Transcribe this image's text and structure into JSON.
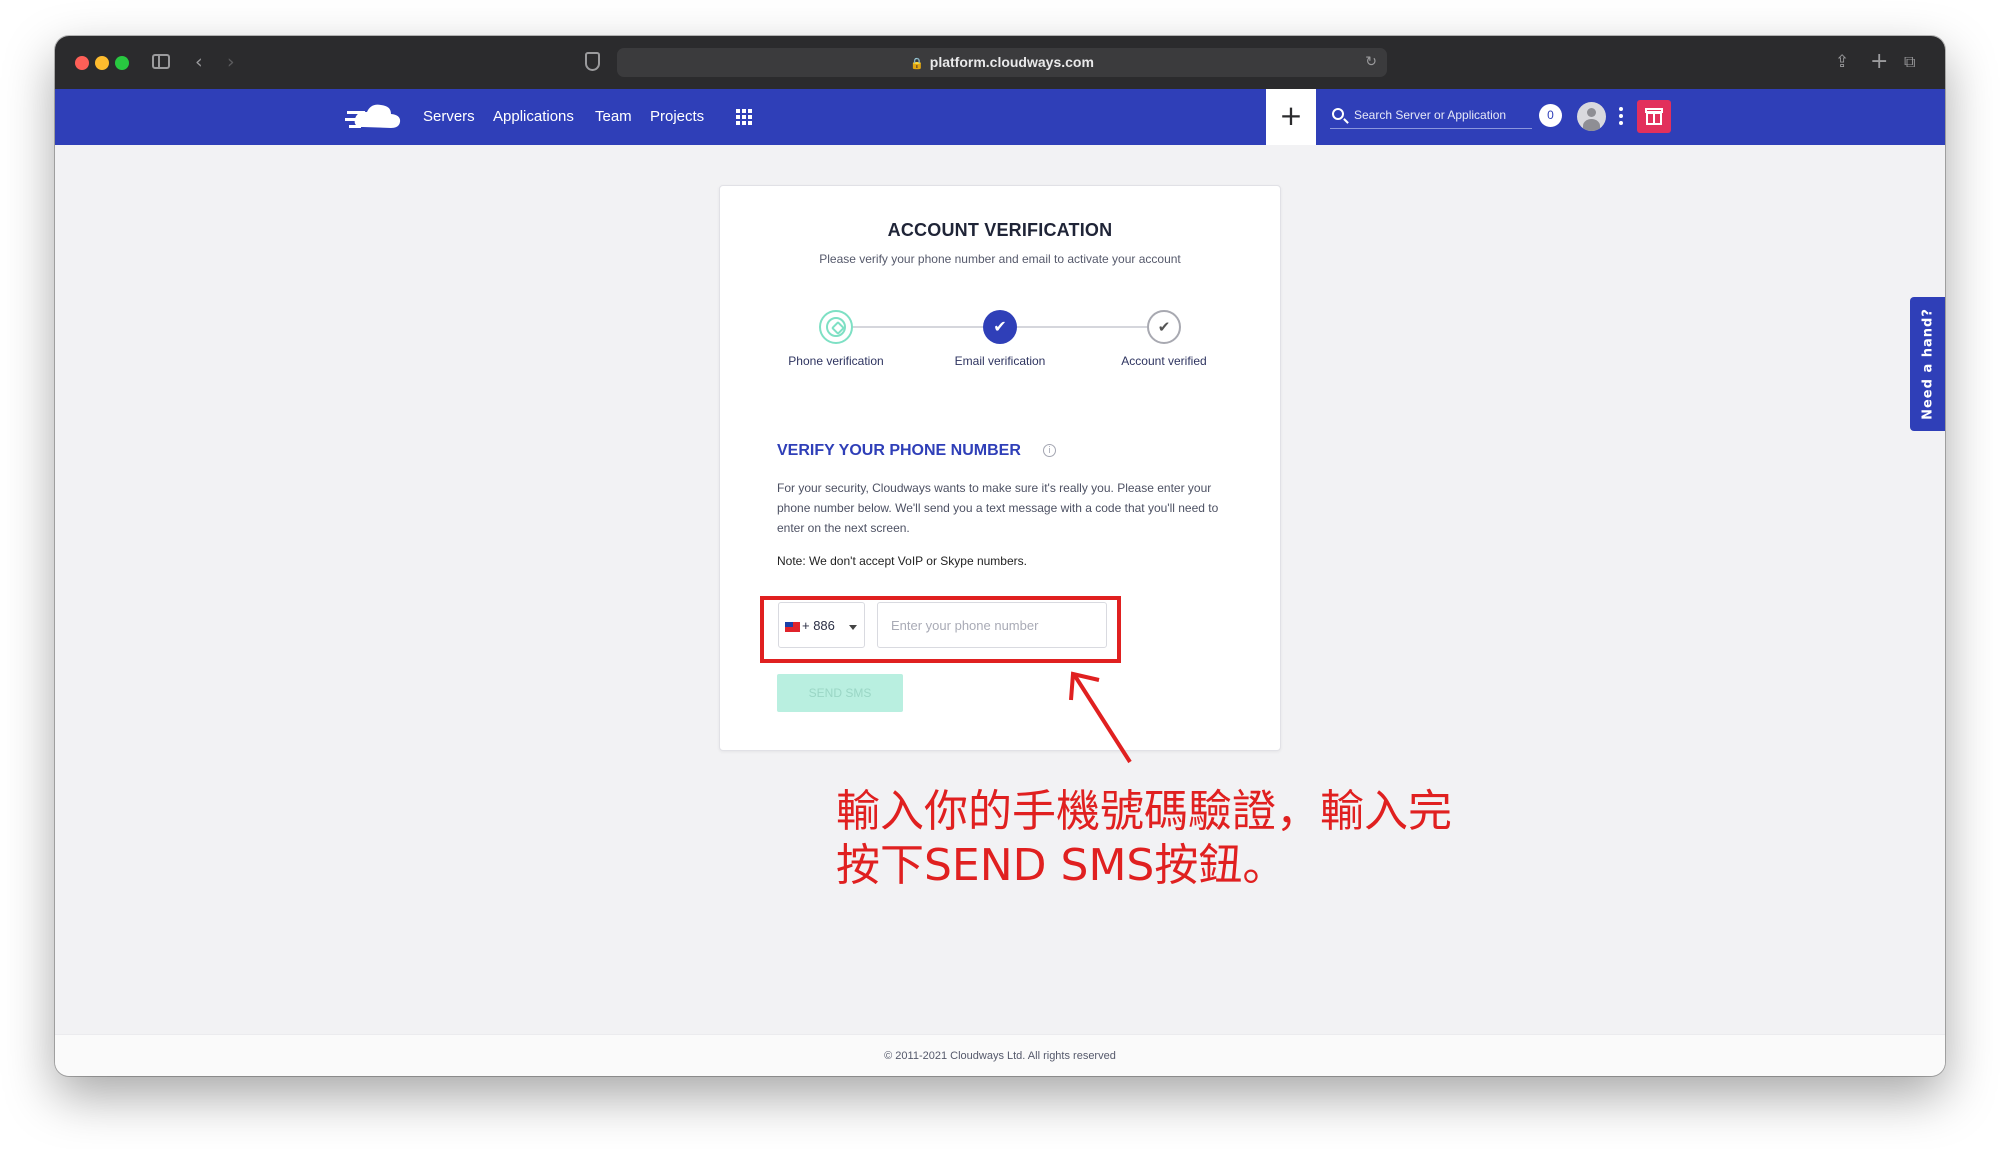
{
  "browser": {
    "url": "platform.cloudways.com"
  },
  "navbar": {
    "links": [
      "Servers",
      "Applications",
      "Team",
      "Projects"
    ],
    "search_placeholder": "Search Server or Application",
    "notification_count": "0",
    "accent_color": "#2f3fb8"
  },
  "card": {
    "title": "ACCOUNT VERIFICATION",
    "subtitle": "Please verify your phone number and email to activate your account",
    "steps": [
      {
        "label": "Phone verification",
        "state": "current"
      },
      {
        "label": "Email verification",
        "state": "completed"
      },
      {
        "label": "Account verified",
        "state": "pending"
      }
    ],
    "section_title": "VERIFY YOUR PHONE NUMBER",
    "description": "For your security, Cloudways wants to make sure it's really you. Please enter your phone number below. We'll send you a text message with a code that you'll need to enter on the next screen.",
    "note": "Note: We don't accept VoIP or Skype numbers.",
    "country_code": "+ 886",
    "country_flag": "taiwan-flag-icon",
    "phone_placeholder": "Enter your phone number",
    "phone_value": "",
    "send_button": "SEND SMS"
  },
  "help_tab": "Need a hand?",
  "annotation": {
    "text": "輸入你的手機號碼驗證，輸入完按下SEND SMS按鈕。",
    "color": "#e02020"
  },
  "footer": "© 2011-2021 Cloudways Ltd. All rights reserved"
}
